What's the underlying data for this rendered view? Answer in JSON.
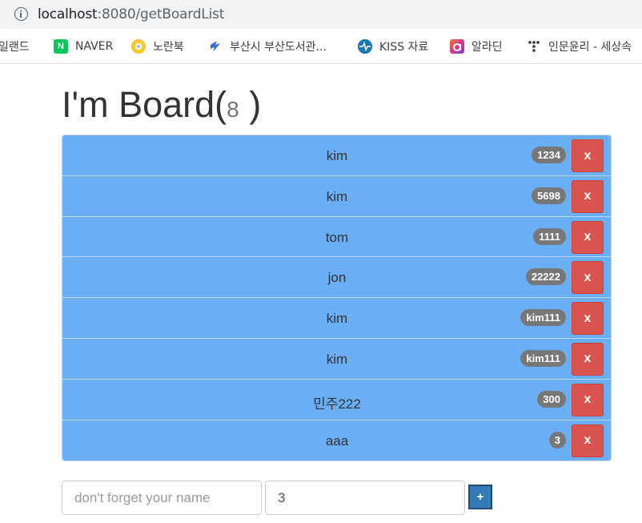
{
  "browser": {
    "url_host": "localhost",
    "url_rest": ":8080/getBoardList"
  },
  "bookmarks": [
    {
      "label": "일랜드",
      "icon": "none",
      "color": ""
    },
    {
      "label": "NAVER",
      "icon": "naver-icon",
      "glyph": "N",
      "color": "#03c75a"
    },
    {
      "label": "노란북",
      "icon": "noranbook-icon",
      "glyph": "",
      "color": "#f2c12e"
    },
    {
      "label": "부산시 부산도서관...",
      "icon": "busan-library-icon",
      "glyph": "≶",
      "color": "#2f6fd8"
    },
    {
      "label": "KISS 자료",
      "icon": "kiss-icon",
      "glyph": "↯",
      "color": "#1e88c7"
    },
    {
      "label": "알라딘",
      "icon": "aladin-icon",
      "glyph": "a",
      "color": "#d8368e"
    },
    {
      "label": "인문윤리 - 세상속",
      "icon": "dots-icon",
      "glyph": "⁘",
      "color": "#ffffff"
    }
  ],
  "board": {
    "title": "I'm Board(",
    "count": "8",
    "title_close": " )",
    "delete_label": "x",
    "items": [
      {
        "name": "kim",
        "badge": "1234"
      },
      {
        "name": "kim",
        "badge": "5698"
      },
      {
        "name": "tom",
        "badge": "1111"
      },
      {
        "name": "jon",
        "badge": "22222"
      },
      {
        "name": "kim",
        "badge": "kim111"
      },
      {
        "name": "kim",
        "badge": "kim111"
      },
      {
        "name": "민주222",
        "badge": "300"
      },
      {
        "name": "aaa",
        "badge": "3"
      }
    ]
  },
  "form": {
    "name_placeholder": "don't forget your name",
    "name_value": "",
    "second_value": "3",
    "add_label": "+"
  },
  "colors": {
    "row_bg": "#6aaef5",
    "badge_bg": "#777777",
    "delete_bg": "#d9534f",
    "add_bg": "#337ab7"
  }
}
